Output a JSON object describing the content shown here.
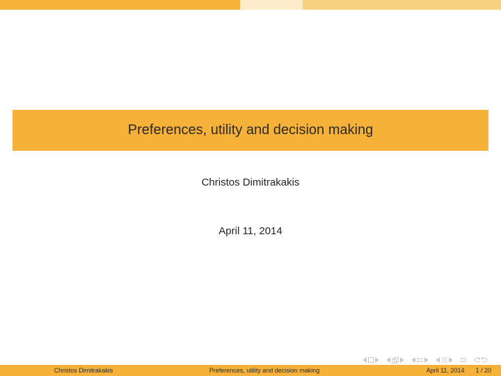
{
  "title": "Preferences, utility and decision making",
  "author": "Christos Dimitrakakis",
  "date": "April 11, 2014",
  "footer": {
    "author": "Christos Dimitrakakis",
    "title": "Preferences, utility and decision making",
    "date": "April 11, 2014",
    "page": "1 / 20"
  }
}
